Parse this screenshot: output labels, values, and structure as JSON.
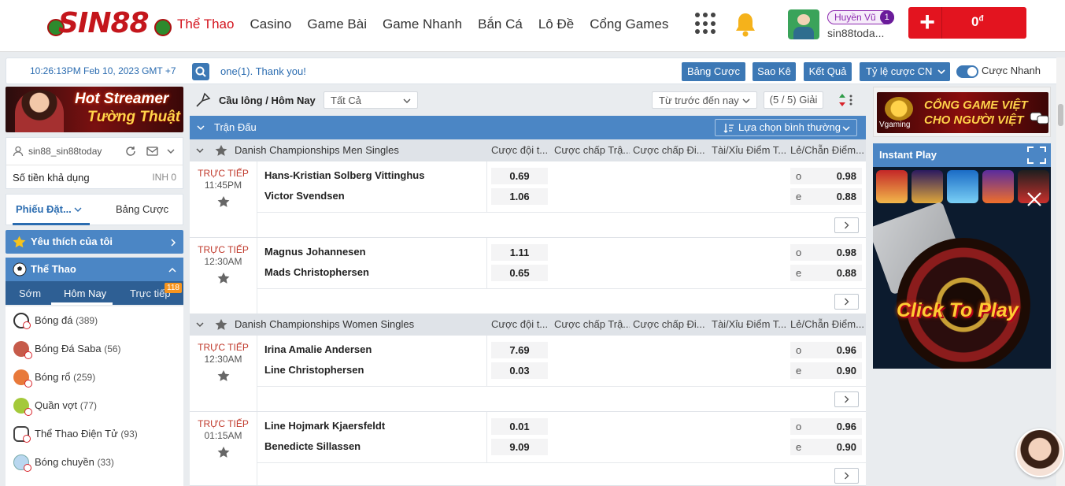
{
  "header": {
    "logo_text": "SIN88",
    "nav": [
      "Thể Thao",
      "Casino",
      "Game Bài",
      "Game Nhanh",
      "Bắn Cá",
      "Lô Đề",
      "Cổng Games"
    ],
    "active_nav": "Thể Thao",
    "vip_name": "Huyền Vũ",
    "vip_level": "1",
    "username": "sin88toda...",
    "balance": "0",
    "balance_unit": "đ"
  },
  "infobar": {
    "clock": "10:26:13PM Feb 10, 2023 GMT +7",
    "marquee": "one(1). Thank you!",
    "buttons": [
      "Bảng Cược",
      "Sao Kê",
      "Kết Quả",
      "Tỷ lệ cược CN"
    ],
    "quick_bet_label": "Cược Nhanh"
  },
  "left": {
    "banner_line1": "Hot Streamer",
    "banner_line2": "Tường Thuật",
    "user": "sin88_sin88today",
    "available_label": "Số tiền khả dụng",
    "available_value": "INH 0",
    "tab1": "Phiếu Đặt...",
    "tab2": "Bảng Cược",
    "favorites": "Yêu thích của tôi",
    "sports_header": "Thể Thao",
    "sport_tabs": [
      "Sớm",
      "Hôm Nay",
      "Trực tiếp"
    ],
    "live_count": "118",
    "sports": [
      {
        "name": "Bóng đá",
        "count": "(389)"
      },
      {
        "name": "Bóng Đá Saba",
        "count": "(56)"
      },
      {
        "name": "Bóng rổ",
        "count": "(259)"
      },
      {
        "name": "Quần vợt",
        "count": "(77)"
      },
      {
        "name": "Thể Thao Điện Tử",
        "count": "(93)"
      },
      {
        "name": "Bóng chuyền",
        "count": "(33)"
      }
    ]
  },
  "center": {
    "title": "Cầu lông / Hôm Nay",
    "filter": "Tất Cả",
    "sort": "Từ trước đến nay",
    "pager": "(5 / 5) Giải",
    "section": "Trận Đấu",
    "select_label": "Lựa chọn bình thường",
    "columns": [
      "Cược đội t...",
      "Cược chấp Trậ...",
      "Cược chấp Đi...",
      "Tài/Xỉu Điểm T...",
      "Lẻ/Chẵn Điểm..."
    ],
    "leagues": [
      {
        "name": "Danish Championships Men Singles",
        "matches": [
          {
            "status": "TRỰC TIẾP",
            "time": "11:45PM",
            "home": "Hans-Kristian Solberg Vittinghus",
            "away": "Victor Svendsen",
            "odd1": "0.69",
            "odd2": "1.06",
            "oe1_label": "o",
            "oe1": "0.98",
            "oe2_label": "e",
            "oe2": "0.88"
          },
          {
            "status": "TRỰC TIẾP",
            "time": "12:30AM",
            "home": "Magnus Johannesen",
            "away": "Mads Christophersen",
            "odd1": "1.11",
            "odd2": "0.65",
            "oe1_label": "o",
            "oe1": "0.98",
            "oe2_label": "e",
            "oe2": "0.88"
          }
        ]
      },
      {
        "name": "Danish Championships Women Singles",
        "matches": [
          {
            "status": "TRỰC TIẾP",
            "time": "12:30AM",
            "home": "Irina Amalie Andersen",
            "away": "Line Christophersen",
            "odd1": "7.69",
            "odd2": "0.03",
            "oe1_label": "o",
            "oe1": "0.96",
            "oe2_label": "e",
            "oe2": "0.90"
          },
          {
            "status": "TRỰC TIẾP",
            "time": "01:15AM",
            "home": "Line Hojmark Kjaersfeldt",
            "away": "Benedicte Sillassen",
            "odd1": "0.01",
            "odd2": "9.09",
            "oe1_label": "o",
            "oe1": "0.96",
            "oe2_label": "e",
            "oe2": "0.90"
          }
        ]
      }
    ]
  },
  "right": {
    "promo_line1": "CỔNG GAME VIỆT",
    "promo_line2": "CHO NGƯỜI VIỆT",
    "promo_brand": "Vgaming",
    "instant_play": "Instant Play",
    "click_to_play": "Click To Play"
  }
}
